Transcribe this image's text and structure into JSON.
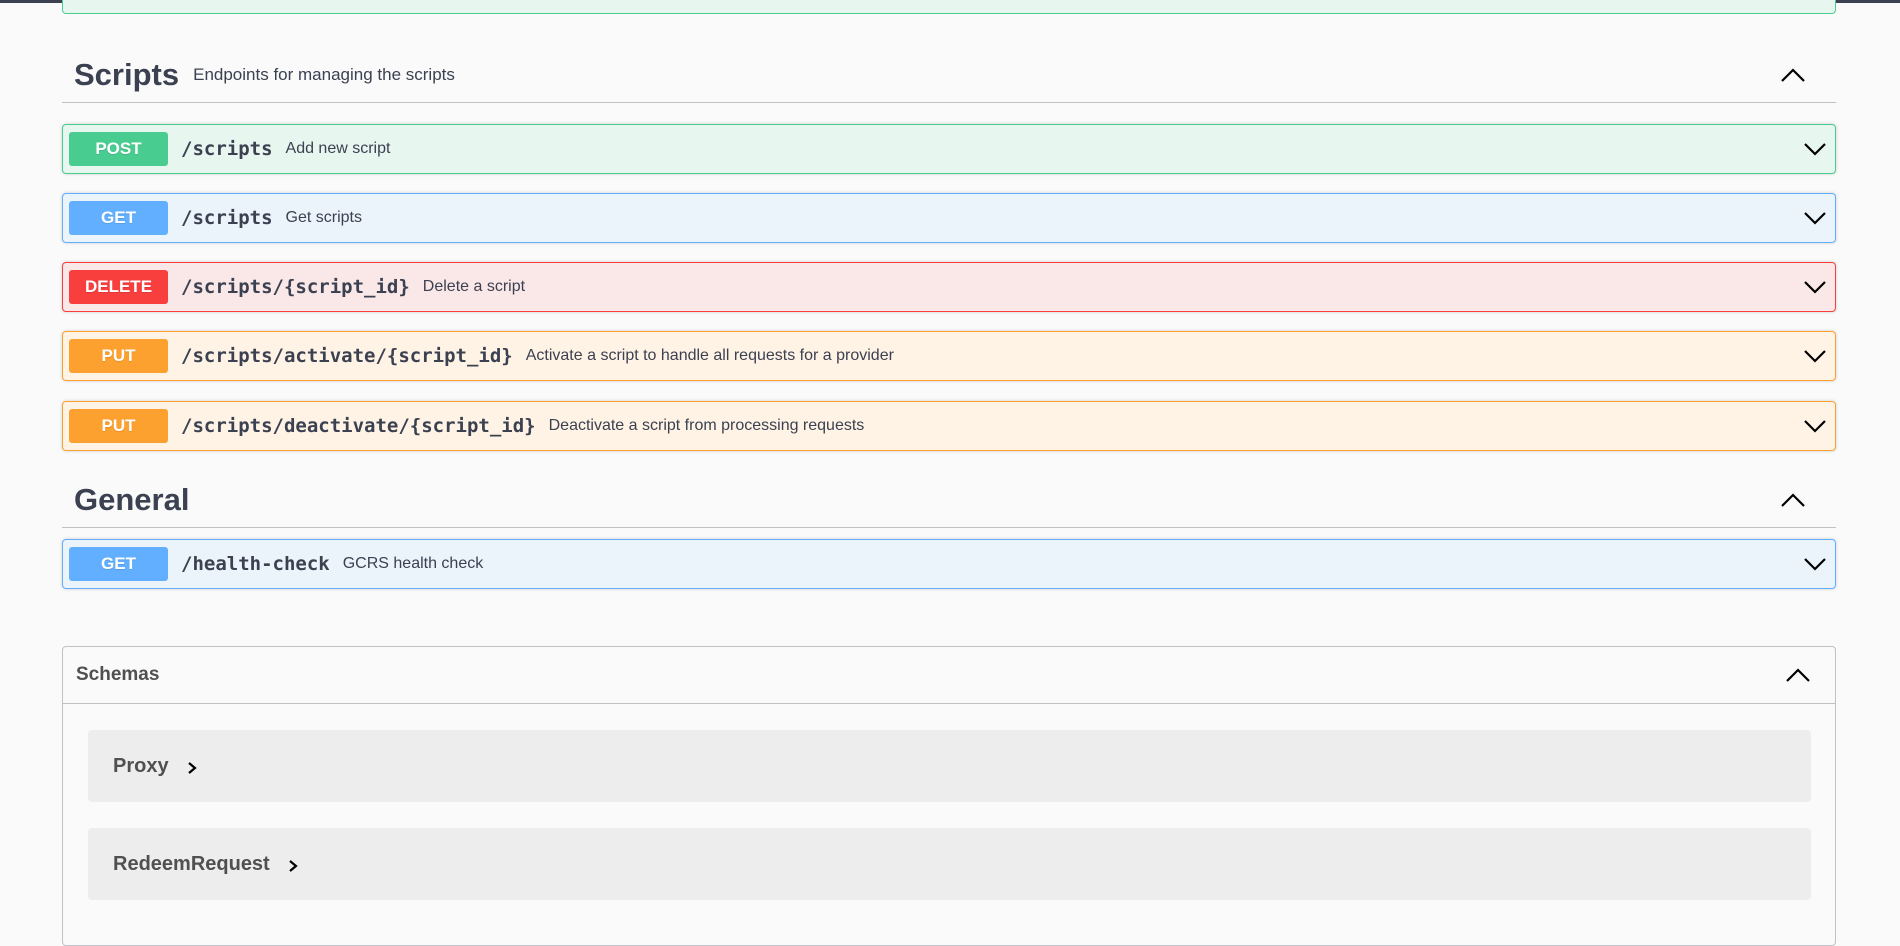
{
  "tags": [
    {
      "name": "Scripts",
      "description": "Endpoints for managing the scripts",
      "operations": [
        {
          "method": "POST",
          "path": "/scripts",
          "summary": "Add new script"
        },
        {
          "method": "GET",
          "path": "/scripts",
          "summary": "Get scripts"
        },
        {
          "method": "DELETE",
          "path": "/scripts/{script_id}",
          "summary": "Delete a script"
        },
        {
          "method": "PUT",
          "path": "/scripts/activate/{script_id}",
          "summary": "Activate a script to handle all requests for a provider"
        },
        {
          "method": "PUT",
          "path": "/scripts/deactivate/{script_id}",
          "summary": "Deactivate a script from processing requests"
        }
      ]
    },
    {
      "name": "General",
      "description": "",
      "operations": [
        {
          "method": "GET",
          "path": "/health-check",
          "summary": "GCRS health check"
        }
      ]
    }
  ],
  "schemas": {
    "title": "Schemas",
    "models": [
      "Proxy",
      "RedeemRequest"
    ]
  },
  "icons": {
    "tag_toggle": "chevron-up-icon",
    "operation_expand": "chevron-down-icon",
    "model_expand": "chevron-right-icon"
  },
  "colors": {
    "post": "#49cc90",
    "get": "#61affe",
    "delete": "#f93e3e",
    "put": "#fca130"
  }
}
